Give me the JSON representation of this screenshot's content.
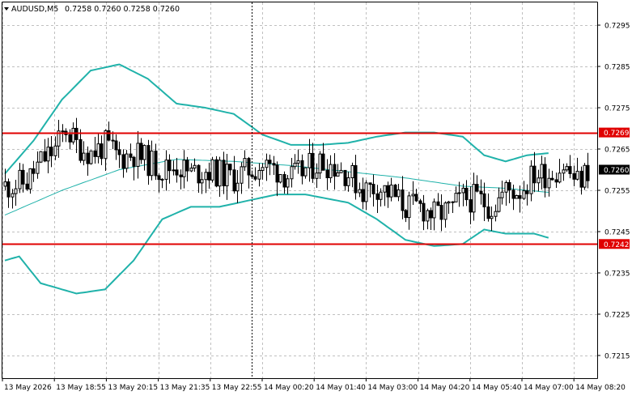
{
  "header": {
    "symbol": "AUDUSD,M5",
    "prices": "0.7258 0.7260 0.7258 0.7260"
  },
  "colors": {
    "candle": "#000000",
    "band": "#20b2aa",
    "level_line": "#e00000",
    "grid": "#c0c0c0"
  },
  "chart_data": {
    "type": "candlestick",
    "symbol": "AUDUSD",
    "timeframe": "M5",
    "ylim": [
      0.72095,
      0.73005
    ],
    "y_ticks": [
      "0.7295",
      "0.7285",
      "0.7275",
      "0.7265",
      "0.7255",
      "0.7245",
      "0.7235",
      "0.7225",
      "0.7215"
    ],
    "x_ticks": [
      "13 May 2026",
      "13 May 18:55",
      "13 May 20:15",
      "13 May 21:35",
      "13 May 22:55",
      "14 May 00:20",
      "14 May 01:40",
      "14 May 03:00",
      "14 May 04:20",
      "14 May 05:40",
      "14 May 07:00",
      "14 May 08:20"
    ],
    "current_price": "0.7260",
    "levels": [
      "0.7269",
      "0.7242"
    ],
    "grid": true,
    "close_path": [
      [
        0,
        0.7256
      ],
      [
        6,
        0.7257
      ],
      [
        10,
        0.7262
      ],
      [
        14,
        0.7265
      ],
      [
        17,
        0.727
      ],
      [
        20,
        0.7266
      ],
      [
        24,
        0.7264
      ],
      [
        28,
        0.7266
      ],
      [
        32,
        0.7263
      ],
      [
        36,
        0.7264
      ],
      [
        40,
        0.7262
      ],
      [
        44,
        0.726
      ],
      [
        48,
        0.7261
      ],
      [
        52,
        0.7259
      ],
      [
        56,
        0.726
      ],
      [
        60,
        0.7259
      ],
      [
        64,
        0.7258
      ],
      [
        68,
        0.726
      ],
      [
        72,
        0.7261
      ],
      [
        76,
        0.726
      ],
      [
        80,
        0.7258
      ],
      [
        84,
        0.726
      ],
      [
        88,
        0.7262
      ],
      [
        92,
        0.7261
      ],
      [
        96,
        0.7259
      ],
      [
        100,
        0.7255
      ],
      [
        104,
        0.7256
      ],
      [
        108,
        0.7254
      ],
      [
        112,
        0.7251
      ],
      [
        116,
        0.7251
      ],
      [
        120,
        0.7249
      ],
      [
        124,
        0.725
      ],
      [
        128,
        0.7253
      ],
      [
        132,
        0.7253
      ],
      [
        136,
        0.7251
      ],
      [
        140,
        0.7255
      ],
      [
        144,
        0.7255
      ],
      [
        148,
        0.7259
      ],
      [
        152,
        0.7259
      ],
      [
        156,
        0.7261
      ],
      [
        160,
        0.7257
      ],
      [
        163,
        0.726
      ]
    ],
    "bands": {
      "upper": [
        [
          0,
          0.7259
        ],
        [
          8,
          0.7267
        ],
        [
          16,
          0.7277
        ],
        [
          24,
          0.7284
        ],
        [
          32,
          0.72855
        ],
        [
          40,
          0.7282
        ],
        [
          48,
          0.7276
        ],
        [
          56,
          0.7275
        ],
        [
          64,
          0.72735
        ],
        [
          72,
          0.72685
        ],
        [
          80,
          0.7266
        ],
        [
          88,
          0.7266
        ],
        [
          96,
          0.72665
        ],
        [
          104,
          0.7268
        ],
        [
          112,
          0.7269
        ],
        [
          120,
          0.7269
        ],
        [
          128,
          0.7268
        ],
        [
          134,
          0.72635
        ],
        [
          140,
          0.7262
        ],
        [
          146,
          0.72635
        ],
        [
          152,
          0.7264
        ]
      ],
      "middle": [
        [
          0,
          0.7249
        ],
        [
          16,
          0.7255
        ],
        [
          32,
          0.726
        ],
        [
          48,
          0.72625
        ],
        [
          64,
          0.7262
        ],
        [
          80,
          0.7261
        ],
        [
          96,
          0.72595
        ],
        [
          112,
          0.7258
        ],
        [
          128,
          0.7256
        ],
        [
          140,
          0.72555
        ],
        [
          152,
          0.72545
        ]
      ],
      "lower": [
        [
          0,
          0.7238
        ],
        [
          4,
          0.7239
        ],
        [
          10,
          0.72325
        ],
        [
          20,
          0.723
        ],
        [
          28,
          0.7231
        ],
        [
          36,
          0.7238
        ],
        [
          44,
          0.7248
        ],
        [
          52,
          0.7251
        ],
        [
          60,
          0.7251
        ],
        [
          68,
          0.72525
        ],
        [
          76,
          0.7254
        ],
        [
          84,
          0.7254
        ],
        [
          96,
          0.7252
        ],
        [
          104,
          0.7248
        ],
        [
          112,
          0.7243
        ],
        [
          120,
          0.72415
        ],
        [
          128,
          0.7242
        ],
        [
          134,
          0.72455
        ],
        [
          140,
          0.72445
        ],
        [
          148,
          0.72445
        ],
        [
          152,
          0.72435
        ]
      ]
    }
  }
}
